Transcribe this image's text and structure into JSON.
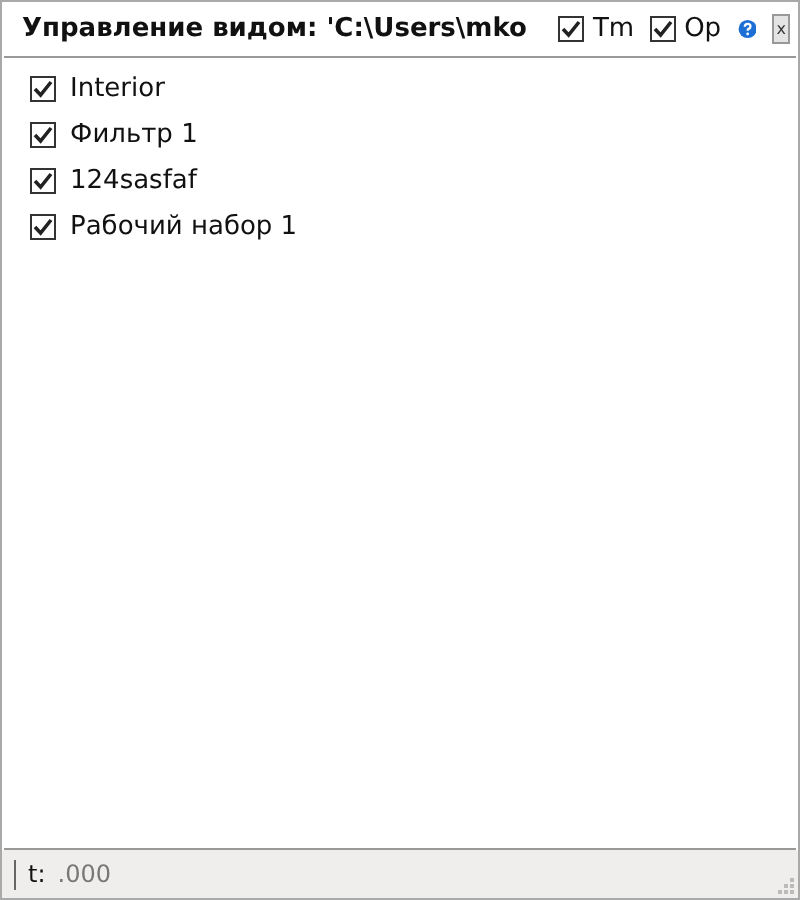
{
  "window": {
    "title": "Управление видом: 'C:\\Users\\mko"
  },
  "toggles": [
    {
      "label": "Tm",
      "checked": true
    },
    {
      "label": "Op",
      "checked": true
    }
  ],
  "close_button": {
    "label": "x"
  },
  "items": [
    {
      "label": "Interior",
      "checked": true
    },
    {
      "label": "Фильтр 1",
      "checked": true
    },
    {
      "label": "124sasfaf",
      "checked": true
    },
    {
      "label": "Рабочий набор 1",
      "checked": true
    }
  ],
  "status_bar": {
    "label": "t:",
    "value": ".000"
  }
}
